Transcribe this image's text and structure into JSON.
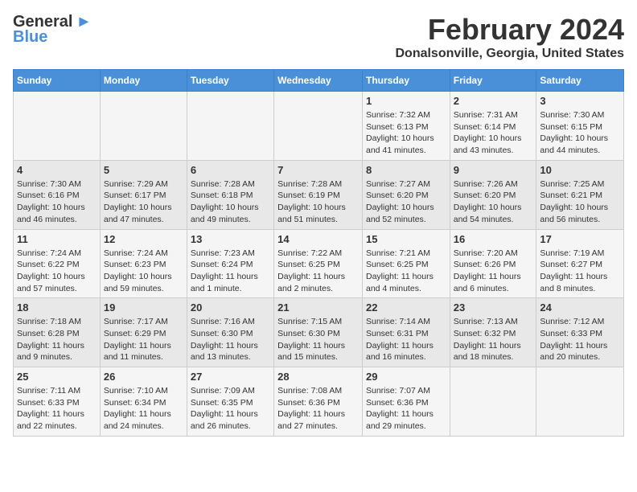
{
  "logo": {
    "general": "General",
    "blue": "Blue"
  },
  "header": {
    "month_year": "February 2024",
    "location": "Donalsonville, Georgia, United States"
  },
  "days_of_week": [
    "Sunday",
    "Monday",
    "Tuesday",
    "Wednesday",
    "Thursday",
    "Friday",
    "Saturday"
  ],
  "weeks": [
    [
      {
        "day": "",
        "sunrise": "",
        "sunset": "",
        "daylight": ""
      },
      {
        "day": "",
        "sunrise": "",
        "sunset": "",
        "daylight": ""
      },
      {
        "day": "",
        "sunrise": "",
        "sunset": "",
        "daylight": ""
      },
      {
        "day": "",
        "sunrise": "",
        "sunset": "",
        "daylight": ""
      },
      {
        "day": "1",
        "sunrise": "7:32 AM",
        "sunset": "6:13 PM",
        "daylight": "10 hours and 41 minutes."
      },
      {
        "day": "2",
        "sunrise": "7:31 AM",
        "sunset": "6:14 PM",
        "daylight": "10 hours and 43 minutes."
      },
      {
        "day": "3",
        "sunrise": "7:30 AM",
        "sunset": "6:15 PM",
        "daylight": "10 hours and 44 minutes."
      }
    ],
    [
      {
        "day": "4",
        "sunrise": "7:30 AM",
        "sunset": "6:16 PM",
        "daylight": "10 hours and 46 minutes."
      },
      {
        "day": "5",
        "sunrise": "7:29 AM",
        "sunset": "6:17 PM",
        "daylight": "10 hours and 47 minutes."
      },
      {
        "day": "6",
        "sunrise": "7:28 AM",
        "sunset": "6:18 PM",
        "daylight": "10 hours and 49 minutes."
      },
      {
        "day": "7",
        "sunrise": "7:28 AM",
        "sunset": "6:19 PM",
        "daylight": "10 hours and 51 minutes."
      },
      {
        "day": "8",
        "sunrise": "7:27 AM",
        "sunset": "6:20 PM",
        "daylight": "10 hours and 52 minutes."
      },
      {
        "day": "9",
        "sunrise": "7:26 AM",
        "sunset": "6:20 PM",
        "daylight": "10 hours and 54 minutes."
      },
      {
        "day": "10",
        "sunrise": "7:25 AM",
        "sunset": "6:21 PM",
        "daylight": "10 hours and 56 minutes."
      }
    ],
    [
      {
        "day": "11",
        "sunrise": "7:24 AM",
        "sunset": "6:22 PM",
        "daylight": "10 hours and 57 minutes."
      },
      {
        "day": "12",
        "sunrise": "7:24 AM",
        "sunset": "6:23 PM",
        "daylight": "10 hours and 59 minutes."
      },
      {
        "day": "13",
        "sunrise": "7:23 AM",
        "sunset": "6:24 PM",
        "daylight": "11 hours and 1 minute."
      },
      {
        "day": "14",
        "sunrise": "7:22 AM",
        "sunset": "6:25 PM",
        "daylight": "11 hours and 2 minutes."
      },
      {
        "day": "15",
        "sunrise": "7:21 AM",
        "sunset": "6:25 PM",
        "daylight": "11 hours and 4 minutes."
      },
      {
        "day": "16",
        "sunrise": "7:20 AM",
        "sunset": "6:26 PM",
        "daylight": "11 hours and 6 minutes."
      },
      {
        "day": "17",
        "sunrise": "7:19 AM",
        "sunset": "6:27 PM",
        "daylight": "11 hours and 8 minutes."
      }
    ],
    [
      {
        "day": "18",
        "sunrise": "7:18 AM",
        "sunset": "6:28 PM",
        "daylight": "11 hours and 9 minutes."
      },
      {
        "day": "19",
        "sunrise": "7:17 AM",
        "sunset": "6:29 PM",
        "daylight": "11 hours and 11 minutes."
      },
      {
        "day": "20",
        "sunrise": "7:16 AM",
        "sunset": "6:30 PM",
        "daylight": "11 hours and 13 minutes."
      },
      {
        "day": "21",
        "sunrise": "7:15 AM",
        "sunset": "6:30 PM",
        "daylight": "11 hours and 15 minutes."
      },
      {
        "day": "22",
        "sunrise": "7:14 AM",
        "sunset": "6:31 PM",
        "daylight": "11 hours and 16 minutes."
      },
      {
        "day": "23",
        "sunrise": "7:13 AM",
        "sunset": "6:32 PM",
        "daylight": "11 hours and 18 minutes."
      },
      {
        "day": "24",
        "sunrise": "7:12 AM",
        "sunset": "6:33 PM",
        "daylight": "11 hours and 20 minutes."
      }
    ],
    [
      {
        "day": "25",
        "sunrise": "7:11 AM",
        "sunset": "6:33 PM",
        "daylight": "11 hours and 22 minutes."
      },
      {
        "day": "26",
        "sunrise": "7:10 AM",
        "sunset": "6:34 PM",
        "daylight": "11 hours and 24 minutes."
      },
      {
        "day": "27",
        "sunrise": "7:09 AM",
        "sunset": "6:35 PM",
        "daylight": "11 hours and 26 minutes."
      },
      {
        "day": "28",
        "sunrise": "7:08 AM",
        "sunset": "6:36 PM",
        "daylight": "11 hours and 27 minutes."
      },
      {
        "day": "29",
        "sunrise": "7:07 AM",
        "sunset": "6:36 PM",
        "daylight": "11 hours and 29 minutes."
      },
      {
        "day": "",
        "sunrise": "",
        "sunset": "",
        "daylight": ""
      },
      {
        "day": "",
        "sunrise": "",
        "sunset": "",
        "daylight": ""
      }
    ]
  ],
  "labels": {
    "sunrise": "Sunrise:",
    "sunset": "Sunset:",
    "daylight": "Daylight:"
  }
}
